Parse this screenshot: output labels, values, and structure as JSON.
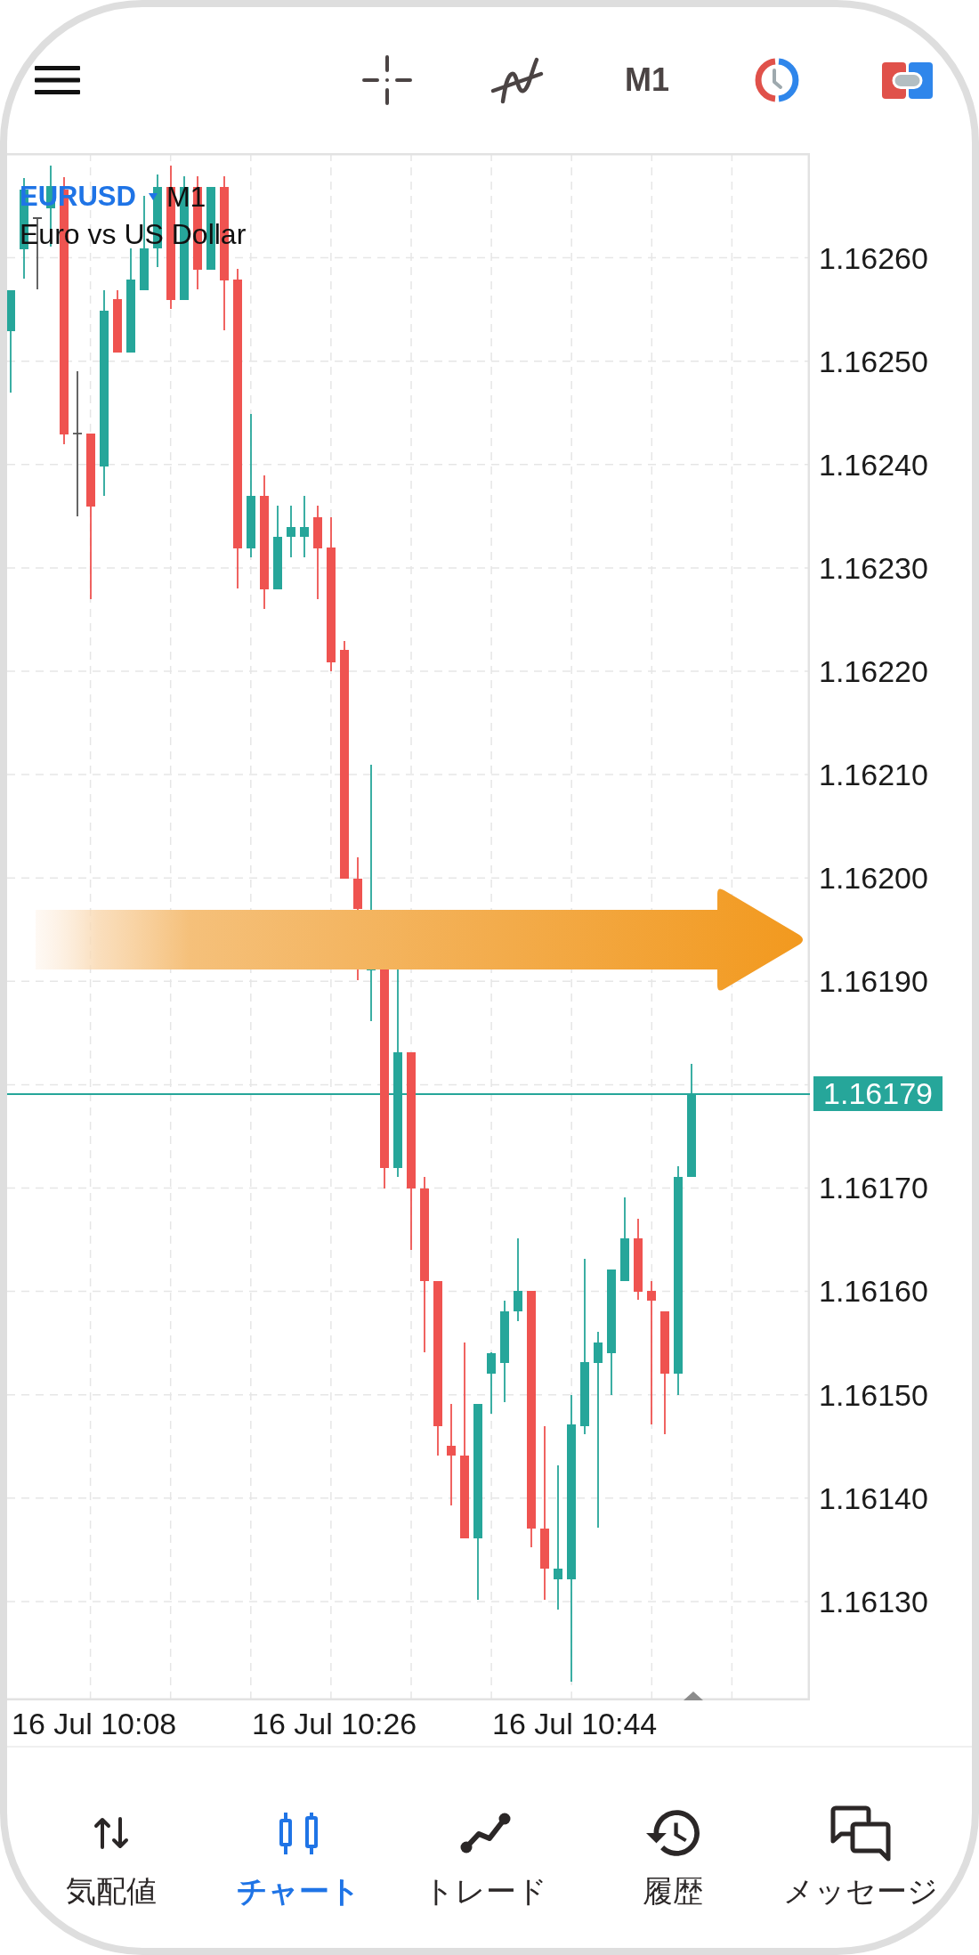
{
  "top_bar": {
    "timeframe": "M1"
  },
  "chart": {
    "symbol": "EURUSD",
    "timeframe": "M1",
    "description": "Euro vs US Dollar",
    "price_axis": [
      {
        "kind": "tick",
        "text": "1.16260"
      },
      {
        "kind": "tick",
        "text": "1.16250"
      },
      {
        "kind": "tick",
        "text": "1.16240"
      },
      {
        "kind": "tick",
        "text": "1.16230"
      },
      {
        "kind": "tick",
        "text": "1.16220"
      },
      {
        "kind": "tick",
        "text": "1.16210"
      },
      {
        "kind": "tick",
        "text": "1.16200"
      },
      {
        "kind": "tick",
        "text": "1.16190"
      },
      {
        "kind": "current",
        "text": "1.16179"
      },
      {
        "kind": "tick",
        "text": "1.16170"
      },
      {
        "kind": "tick",
        "text": "1.16160"
      },
      {
        "kind": "tick",
        "text": "1.16150"
      },
      {
        "kind": "tick",
        "text": "1.16140"
      },
      {
        "kind": "tick",
        "text": "1.16130"
      }
    ],
    "time_axis": [
      "16 Jul 10:08",
      "16 Jul 10:26",
      "16 Jul 10:44"
    ]
  },
  "bottom_nav": [
    {
      "label": "気配値",
      "selected": false
    },
    {
      "label": "チャート",
      "selected": true
    },
    {
      "label": "トレード",
      "selected": false
    },
    {
      "label": "履歴",
      "selected": false
    },
    {
      "label": "メッセージ",
      "selected": false
    }
  ]
}
